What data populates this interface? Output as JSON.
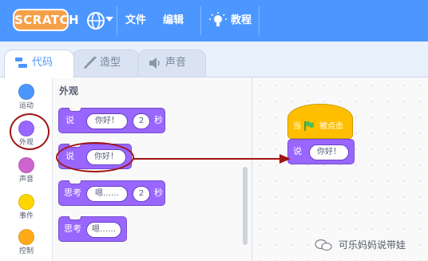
{
  "menubar": {
    "logo": "SCRATCH",
    "items": [
      "文件",
      "编辑"
    ],
    "tutorials": "教程"
  },
  "tabs": [
    {
      "label": "代码",
      "active": true,
      "icon": "code-icon"
    },
    {
      "label": "造型",
      "active": false,
      "icon": "brush-icon"
    },
    {
      "label": "声音",
      "active": false,
      "icon": "speaker-icon"
    }
  ],
  "categories": [
    {
      "label": "运动",
      "color": "#4c97ff"
    },
    {
      "label": "外观",
      "color": "#9966ff"
    },
    {
      "label": "声音",
      "color": "#cf63cf"
    },
    {
      "label": "事件",
      "color": "#ffd500"
    },
    {
      "label": "控制",
      "color": "#ffab19"
    }
  ],
  "palette": {
    "title": "外观",
    "blocks": [
      {
        "verb": "说",
        "text": "你好！",
        "num": "2",
        "unit": "秒"
      },
      {
        "verb": "说",
        "text": "你好！"
      },
      {
        "verb": "思考",
        "text": "嗯……",
        "num": "2",
        "unit": "秒"
      },
      {
        "verb": "思考",
        "text": "嗯……"
      }
    ]
  },
  "script": {
    "hat_prefix": "当",
    "hat_suffix": "被点击",
    "say_verb": "说",
    "say_text": "你好！"
  },
  "watermark": "可乐妈妈说带娃",
  "colors": {
    "menubar": "#4c97ff",
    "looks": "#9966ff",
    "events": "#ffbf00",
    "annotation": "#a11414"
  }
}
